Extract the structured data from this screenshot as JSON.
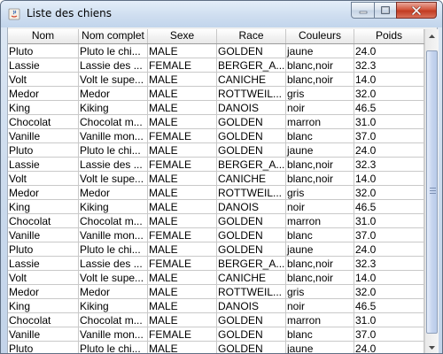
{
  "window": {
    "title": "Liste des chiens",
    "app_icon": "java-icon",
    "controls": {
      "minimize_icon": "minimize-icon",
      "maximize_icon": "maximize-icon",
      "close_icon": "close-icon"
    }
  },
  "table": {
    "columns": [
      "Nom",
      "Nom complet",
      "Sexe",
      "Race",
      "Couleurs",
      "Poids"
    ],
    "rows": [
      [
        "Pluto",
        "Pluto le chi...",
        "MALE",
        "GOLDEN",
        "jaune",
        "24.0"
      ],
      [
        "Lassie",
        "Lassie des ...",
        "FEMALE",
        "BERGER_A...",
        "blanc,noir",
        "32.3"
      ],
      [
        "Volt",
        "Volt le supe...",
        "MALE",
        "CANICHE",
        "blanc,noir",
        "14.0"
      ],
      [
        "Medor",
        "Medor",
        "MALE",
        "ROTTWEIL...",
        "gris",
        "32.0"
      ],
      [
        "King",
        "Kiking",
        "MALE",
        "DANOIS",
        "noir",
        "46.5"
      ],
      [
        "Chocolat",
        "Chocolat m...",
        "MALE",
        "GOLDEN",
        "marron",
        "31.0"
      ],
      [
        "Vanille",
        "Vanille mon...",
        "FEMALE",
        "GOLDEN",
        "blanc",
        "37.0"
      ],
      [
        "Pluto",
        "Pluto le chi...",
        "MALE",
        "GOLDEN",
        "jaune",
        "24.0"
      ],
      [
        "Lassie",
        "Lassie des ...",
        "FEMALE",
        "BERGER_A...",
        "blanc,noir",
        "32.3"
      ],
      [
        "Volt",
        "Volt le supe...",
        "MALE",
        "CANICHE",
        "blanc,noir",
        "14.0"
      ],
      [
        "Medor",
        "Medor",
        "MALE",
        "ROTTWEIL...",
        "gris",
        "32.0"
      ],
      [
        "King",
        "Kiking",
        "MALE",
        "DANOIS",
        "noir",
        "46.5"
      ],
      [
        "Chocolat",
        "Chocolat m...",
        "MALE",
        "GOLDEN",
        "marron",
        "31.0"
      ],
      [
        "Vanille",
        "Vanille mon...",
        "FEMALE",
        "GOLDEN",
        "blanc",
        "37.0"
      ],
      [
        "Pluto",
        "Pluto le chi...",
        "MALE",
        "GOLDEN",
        "jaune",
        "24.0"
      ],
      [
        "Lassie",
        "Lassie des ...",
        "FEMALE",
        "BERGER_A...",
        "blanc,noir",
        "32.3"
      ],
      [
        "Volt",
        "Volt le supe...",
        "MALE",
        "CANICHE",
        "blanc,noir",
        "14.0"
      ],
      [
        "Medor",
        "Medor",
        "MALE",
        "ROTTWEIL...",
        "gris",
        "32.0"
      ],
      [
        "King",
        "Kiking",
        "MALE",
        "DANOIS",
        "noir",
        "46.5"
      ],
      [
        "Chocolat",
        "Chocolat m...",
        "MALE",
        "GOLDEN",
        "marron",
        "31.0"
      ],
      [
        "Vanille",
        "Vanille mon...",
        "FEMALE",
        "GOLDEN",
        "blanc",
        "37.0"
      ],
      [
        "Pluto",
        "Pluto le chi...",
        "MALE",
        "GOLDEN",
        "jaune",
        "24.0"
      ]
    ]
  },
  "scrollbar": {
    "up_icon": "scroll-up-arrow-icon",
    "down_icon": "scroll-down-arrow-icon",
    "grip_icon": "scroll-grip-icon"
  },
  "colors": {
    "close_button": "#c23b22",
    "titlebar": "#cfdef0",
    "grid_line": "#c9c9c9"
  }
}
